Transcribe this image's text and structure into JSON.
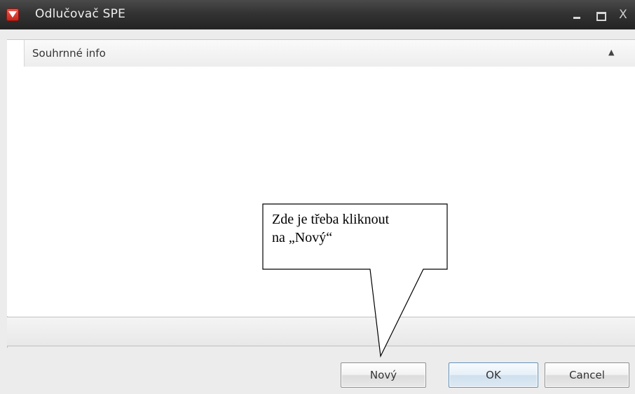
{
  "window": {
    "title": "Odlučovač SPE",
    "controls": {
      "minimize": "-",
      "maximize": "□",
      "close": "X"
    }
  },
  "header": {
    "label": "Souhrnné info",
    "collapse_icon": "▲"
  },
  "callout": {
    "line1": "Zde je třeba kliknout",
    "line2": "na „Nový“"
  },
  "buttons": {
    "new": "Nový",
    "ok": "OK",
    "cancel": "Cancel"
  },
  "colors": {
    "titlebar": "#2e2e2e",
    "app_icon": "#d9362b"
  }
}
